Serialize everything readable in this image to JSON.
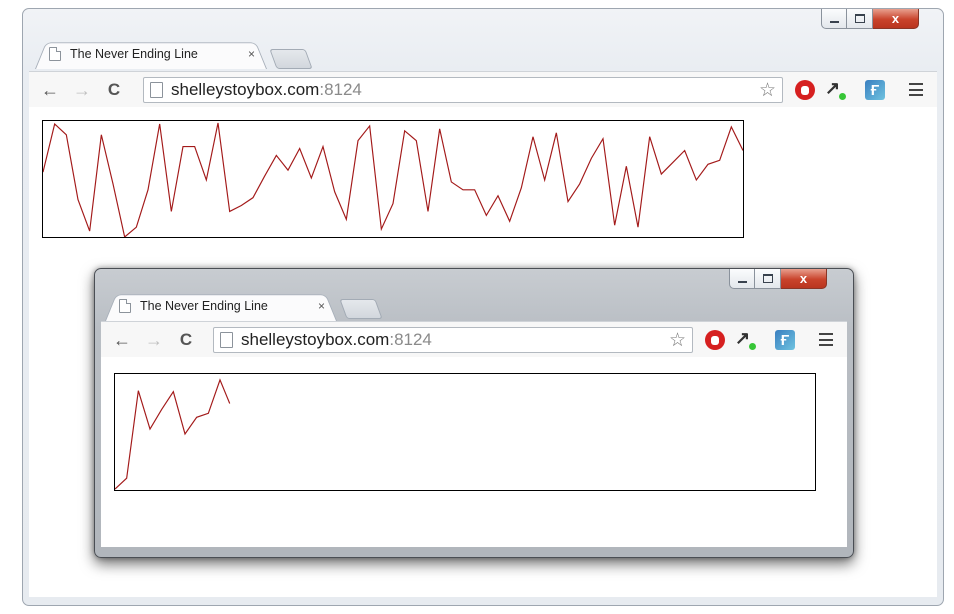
{
  "outer_window": {
    "tab": {
      "title": "The Never Ending Line",
      "close": "×"
    },
    "address": {
      "host": "shelleystoybox.com",
      "port": ":8124"
    },
    "caption": {
      "close": "x"
    },
    "line_color": "#a31a1a",
    "line_points": [
      [
        0,
        52
      ],
      [
        12,
        3
      ],
      [
        24,
        14
      ],
      [
        36,
        80
      ],
      [
        48,
        112
      ],
      [
        60,
        14
      ],
      [
        72,
        64
      ],
      [
        84,
        118
      ],
      [
        96,
        108
      ],
      [
        108,
        70
      ],
      [
        120,
        3
      ],
      [
        132,
        92
      ],
      [
        144,
        26
      ],
      [
        156,
        26
      ],
      [
        168,
        60
      ],
      [
        180,
        2
      ],
      [
        192,
        92
      ],
      [
        204,
        86
      ],
      [
        216,
        78
      ],
      [
        228,
        56
      ],
      [
        240,
        35
      ],
      [
        252,
        50
      ],
      [
        264,
        28
      ],
      [
        276,
        58
      ],
      [
        288,
        26
      ],
      [
        300,
        72
      ],
      [
        312,
        100
      ],
      [
        324,
        20
      ],
      [
        336,
        5
      ],
      [
        348,
        110
      ],
      [
        360,
        84
      ],
      [
        372,
        10
      ],
      [
        384,
        20
      ],
      [
        396,
        92
      ],
      [
        408,
        8
      ],
      [
        420,
        62
      ],
      [
        432,
        70
      ],
      [
        444,
        70
      ],
      [
        456,
        96
      ],
      [
        468,
        76
      ],
      [
        480,
        102
      ],
      [
        492,
        68
      ],
      [
        504,
        16
      ],
      [
        516,
        60
      ],
      [
        528,
        12
      ],
      [
        540,
        82
      ],
      [
        552,
        64
      ],
      [
        564,
        38
      ],
      [
        576,
        18
      ],
      [
        588,
        106
      ],
      [
        600,
        46
      ],
      [
        612,
        108
      ],
      [
        624,
        16
      ],
      [
        636,
        54
      ],
      [
        648,
        42
      ],
      [
        660,
        30
      ],
      [
        672,
        60
      ],
      [
        684,
        44
      ],
      [
        696,
        40
      ],
      [
        708,
        6
      ],
      [
        720,
        30
      ]
    ]
  },
  "inner_window": {
    "tab": {
      "title": "The Never Ending Line",
      "close": "×"
    },
    "address": {
      "host": "shelleystoybox.com",
      "port": ":8124"
    },
    "caption": {
      "close": "x"
    },
    "line_color": "#a31a1a",
    "line_points": [
      [
        0,
        117
      ],
      [
        12,
        106
      ],
      [
        24,
        17
      ],
      [
        36,
        56
      ],
      [
        48,
        36
      ],
      [
        60,
        18
      ],
      [
        72,
        61
      ],
      [
        84,
        44
      ],
      [
        96,
        40
      ],
      [
        108,
        6
      ],
      [
        118,
        30
      ]
    ]
  },
  "colors": {
    "accent_red": "#c9432b",
    "ext_stop": "#d62020",
    "ext_green": "#37c637",
    "ext_blue": "#3a7fc0"
  }
}
